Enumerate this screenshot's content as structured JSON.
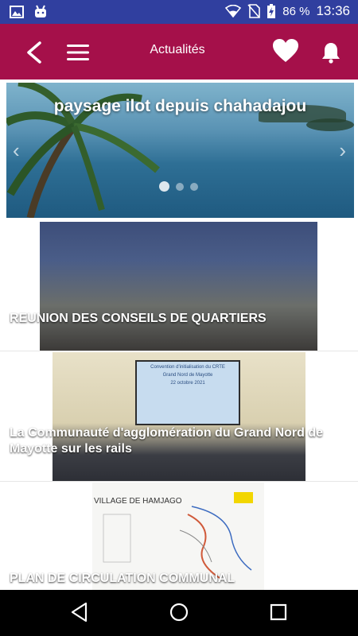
{
  "status_bar": {
    "battery": "86 %",
    "time": "13:36"
  },
  "app_bar": {
    "title": "Actualités"
  },
  "slider": {
    "caption": "paysage ilot depuis chahadajou",
    "prev_glyph": "‹",
    "next_glyph": "›",
    "slide_count": 3,
    "active_slide": 1
  },
  "news": [
    {
      "headline": "REUNION DES CONSEILS DE QUARTIERS"
    },
    {
      "headline": "La Communauté d'agglomération du Grand Nord de Mayotte sur les rails",
      "screen_text": [
        "Convention d'initialisation du CRTE",
        "Grand Nord de Mayotte",
        "22 octobre 2021"
      ]
    },
    {
      "headline": "PLAN DE CIRCULATION COMMUNAL",
      "map_title": "VILLAGE DE HAMJAGO"
    }
  ],
  "colors": {
    "status_bar": "#303F9F",
    "app_bar": "#A5104A",
    "nav_bar": "#000000"
  }
}
